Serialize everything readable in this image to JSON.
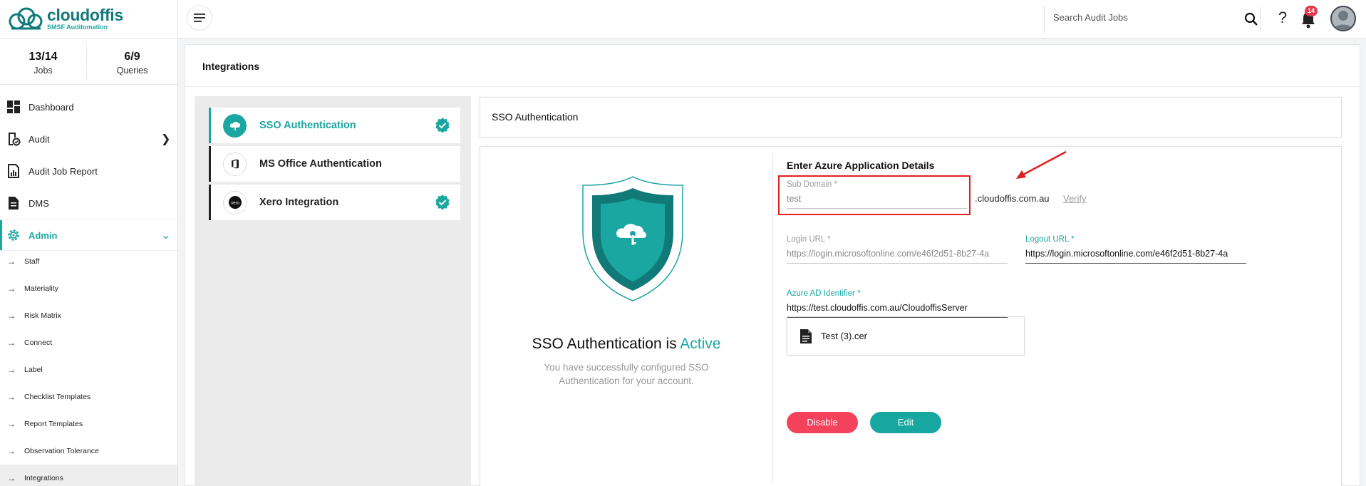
{
  "brand": {
    "name": "cloudoffis",
    "tagline": "SMSF Auditomation"
  },
  "header": {
    "search_placeholder": "Search Audit Jobs",
    "help_icon": "help-icon",
    "notification_count": "14"
  },
  "sidebar": {
    "stats": [
      {
        "value": "13/14",
        "label": "Jobs"
      },
      {
        "value": "6/9",
        "label": "Queries"
      }
    ],
    "nav": [
      {
        "label": "Dashboard",
        "icon": "dashboard-icon"
      },
      {
        "label": "Audit",
        "icon": "audit-icon"
      },
      {
        "label": "Audit Job Report",
        "icon": "report-icon"
      },
      {
        "label": "DMS",
        "icon": "document-icon"
      },
      {
        "label": "Admin",
        "icon": "gear-icon"
      }
    ],
    "admin_items": [
      "Staff",
      "Materiality",
      "Risk Matrix",
      "Connect",
      "Label",
      "Checklist Templates",
      "Report Templates",
      "Observation Tolerance",
      "Integrations"
    ]
  },
  "page": {
    "title": "Integrations",
    "integrations": [
      {
        "label": "SSO Authentication",
        "active": true,
        "verified": true
      },
      {
        "label": "MS Office Authentication",
        "active": false,
        "verified": false
      },
      {
        "label": "Xero Integration",
        "active": false,
        "verified": true
      }
    ],
    "panel_title": "SSO Authentication",
    "status": {
      "prefix": "SSO Authentication is ",
      "state": "Active",
      "description": "You have successfully configured SSO Authentication for your account."
    },
    "form": {
      "title": "Enter Azure Application Details",
      "sub_domain": {
        "label": "Sub Domain",
        "value": "test",
        "suffix": ".cloudoffis.com.au",
        "verify": "Verify"
      },
      "login_url": {
        "label": "Login URL",
        "value": "https://login.microsoftonline.com/e46f2d51-8b27-4a"
      },
      "logout_url": {
        "label": "Logout URL",
        "value": "https://login.microsoftonline.com/e46f2d51-8b27-4a"
      },
      "azure_ad_identifier": {
        "label": "Azure AD Identifier",
        "value": "https://test.cloudoffis.com.au/CloudoffisServer"
      },
      "required_mark": "*",
      "file_name": "Test (3).cer"
    },
    "buttons": {
      "disable": "Disable",
      "edit": "Edit"
    }
  },
  "colors": {
    "teal": "#1aa7a2",
    "brand_dark": "#117a78",
    "danger": "#f4425c",
    "highlight": "#e02020"
  }
}
